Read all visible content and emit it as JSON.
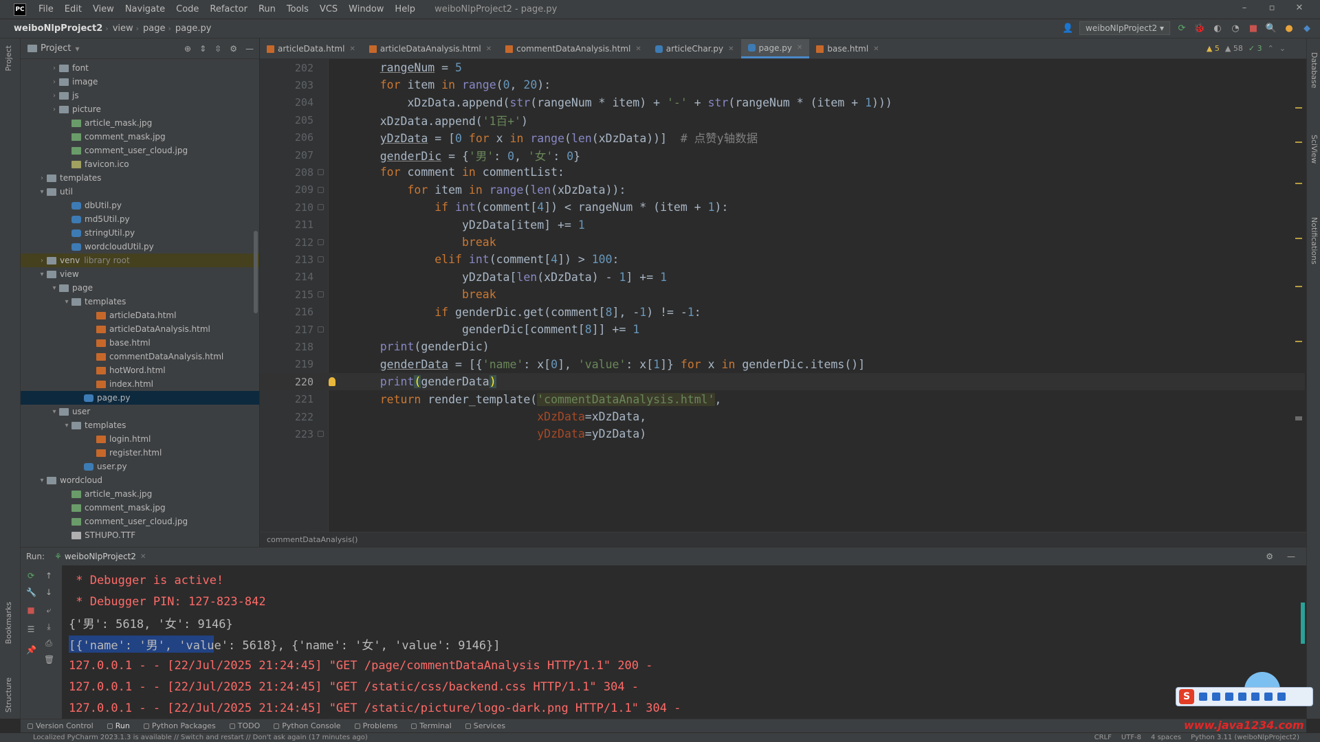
{
  "menubar": {
    "items": [
      "File",
      "Edit",
      "View",
      "Navigate",
      "Code",
      "Refactor",
      "Run",
      "Tools",
      "VCS",
      "Window",
      "Help"
    ],
    "window_title": "weiboNlpProject2 - page.py"
  },
  "navbar": {
    "project": "weiboNlpProject2",
    "path": [
      "view",
      "page",
      "page.py"
    ],
    "run_config": "weiboNlpProject2"
  },
  "project_panel": {
    "title": "Project",
    "tree": [
      {
        "label": "font",
        "type": "folder",
        "depth": 2,
        "open": false
      },
      {
        "label": "image",
        "type": "folder",
        "depth": 2,
        "open": false
      },
      {
        "label": "js",
        "type": "folder",
        "depth": 2,
        "open": false
      },
      {
        "label": "picture",
        "type": "folder",
        "depth": 2,
        "open": false
      },
      {
        "label": "article_mask.jpg",
        "type": "img",
        "depth": 3
      },
      {
        "label": "comment_mask.jpg",
        "type": "img",
        "depth": 3
      },
      {
        "label": "comment_user_cloud.jpg",
        "type": "img",
        "depth": 3
      },
      {
        "label": "favicon.ico",
        "type": "ico",
        "depth": 3
      },
      {
        "label": "templates",
        "type": "folder",
        "depth": 1,
        "open": false
      },
      {
        "label": "util",
        "type": "folder",
        "depth": 1,
        "open": true
      },
      {
        "label": "dbUtil.py",
        "type": "py",
        "depth": 3
      },
      {
        "label": "md5Util.py",
        "type": "py",
        "depth": 3
      },
      {
        "label": "stringUtil.py",
        "type": "py",
        "depth": 3
      },
      {
        "label": "wordcloudUtil.py",
        "type": "py",
        "depth": 3
      },
      {
        "label": "venv",
        "sub": "library root",
        "type": "folder",
        "depth": 1,
        "open": false,
        "highlight": true
      },
      {
        "label": "view",
        "type": "folder",
        "depth": 1,
        "open": true
      },
      {
        "label": "page",
        "type": "folder",
        "depth": 2,
        "open": true
      },
      {
        "label": "templates",
        "type": "folder",
        "depth": 3,
        "open": true
      },
      {
        "label": "articleData.html",
        "type": "html",
        "depth": 5
      },
      {
        "label": "articleDataAnalysis.html",
        "type": "html",
        "depth": 5
      },
      {
        "label": "base.html",
        "type": "html",
        "depth": 5
      },
      {
        "label": "commentDataAnalysis.html",
        "type": "html",
        "depth": 5
      },
      {
        "label": "hotWord.html",
        "type": "html",
        "depth": 5
      },
      {
        "label": "index.html",
        "type": "html",
        "depth": 5
      },
      {
        "label": "page.py",
        "type": "py",
        "depth": 4,
        "selected": true
      },
      {
        "label": "user",
        "type": "folder",
        "depth": 2,
        "open": true
      },
      {
        "label": "templates",
        "type": "folder",
        "depth": 3,
        "open": true
      },
      {
        "label": "login.html",
        "type": "html",
        "depth": 5
      },
      {
        "label": "register.html",
        "type": "html",
        "depth": 5
      },
      {
        "label": "user.py",
        "type": "py",
        "depth": 4
      },
      {
        "label": "wordcloud",
        "type": "folder",
        "depth": 1,
        "open": true
      },
      {
        "label": "article_mask.jpg",
        "type": "img",
        "depth": 3
      },
      {
        "label": "comment_mask.jpg",
        "type": "img",
        "depth": 3
      },
      {
        "label": "comment_user_cloud.jpg",
        "type": "img",
        "depth": 3
      },
      {
        "label": "STHUPO.TTF",
        "type": "ttf",
        "depth": 3
      }
    ]
  },
  "editor_tabs": [
    {
      "label": "articleData.html",
      "type": "html"
    },
    {
      "label": "articleDataAnalysis.html",
      "type": "html"
    },
    {
      "label": "commentDataAnalysis.html",
      "type": "html"
    },
    {
      "label": "articleChar.py",
      "type": "py"
    },
    {
      "label": "page.py",
      "type": "py",
      "active": true
    },
    {
      "label": "base.html",
      "type": "html"
    }
  ],
  "inspections": {
    "warnings": "5",
    "weak": "58",
    "ok": "3"
  },
  "code_lines": [
    {
      "n": "202",
      "tokens": [
        [
          "    ",
          ""
        ],
        [
          "rangeNum",
          "ul"
        ],
        [
          " = ",
          ""
        ],
        [
          "5",
          "num"
        ]
      ]
    },
    {
      "n": "203",
      "tokens": [
        [
          "    ",
          ""
        ],
        [
          "for",
          "kw"
        ],
        [
          " item ",
          ""
        ],
        [
          "in",
          "kw"
        ],
        [
          " ",
          ""
        ],
        [
          "range",
          "fn"
        ],
        [
          "(",
          ""
        ],
        [
          "0",
          "num"
        ],
        [
          ", ",
          ""
        ],
        [
          "20",
          "num"
        ],
        [
          "):",
          ""
        ]
      ]
    },
    {
      "n": "204",
      "tokens": [
        [
          "        xDzData.append(",
          ""
        ],
        [
          "str",
          "fn"
        ],
        [
          "(rangeNum * item) + ",
          ""
        ],
        [
          "'-'",
          "str"
        ],
        [
          " + ",
          ""
        ],
        [
          "str",
          "fn"
        ],
        [
          "(rangeNum * (item + ",
          ""
        ],
        [
          "1",
          "num"
        ],
        [
          ")))",
          ""
        ]
      ]
    },
    {
      "n": "205",
      "tokens": [
        [
          "    xDzData.append(",
          ""
        ],
        [
          "'1百+'",
          "str"
        ],
        [
          ")",
          ""
        ]
      ]
    },
    {
      "n": "206",
      "tokens": [
        [
          "    ",
          ""
        ],
        [
          "yDzData",
          "ul"
        ],
        [
          " = [",
          ""
        ],
        [
          "0",
          "num"
        ],
        [
          " ",
          ""
        ],
        [
          "for",
          "kw"
        ],
        [
          " x ",
          ""
        ],
        [
          "in",
          "kw"
        ],
        [
          " ",
          ""
        ],
        [
          "range",
          "fn"
        ],
        [
          "(",
          ""
        ],
        [
          "len",
          "fn"
        ],
        [
          "(xDzData))]  ",
          ""
        ],
        [
          "# 点赞y轴数据",
          "cm"
        ]
      ]
    },
    {
      "n": "207",
      "tokens": [
        [
          "    ",
          ""
        ],
        [
          "genderDic",
          "ul"
        ],
        [
          " = {",
          ""
        ],
        [
          "'男'",
          "str"
        ],
        [
          ": ",
          ""
        ],
        [
          "0",
          "num"
        ],
        [
          ", ",
          ""
        ],
        [
          "'女'",
          "str"
        ],
        [
          ": ",
          ""
        ],
        [
          "0",
          "num"
        ],
        [
          "}",
          ""
        ]
      ]
    },
    {
      "n": "208",
      "fold": true,
      "tokens": [
        [
          "    ",
          ""
        ],
        [
          "for",
          "kw"
        ],
        [
          " comment ",
          ""
        ],
        [
          "in",
          "kw"
        ],
        [
          " commentList:",
          ""
        ]
      ]
    },
    {
      "n": "209",
      "fold": true,
      "tokens": [
        [
          "        ",
          ""
        ],
        [
          "for",
          "kw"
        ],
        [
          " item ",
          ""
        ],
        [
          "in",
          "kw"
        ],
        [
          " ",
          ""
        ],
        [
          "range",
          "fn"
        ],
        [
          "(",
          ""
        ],
        [
          "len",
          "fn"
        ],
        [
          "(xDzData)):",
          ""
        ]
      ]
    },
    {
      "n": "210",
      "fold": true,
      "tokens": [
        [
          "            ",
          ""
        ],
        [
          "if",
          "kw"
        ],
        [
          " ",
          ""
        ],
        [
          "int",
          "fn"
        ],
        [
          "(comment[",
          ""
        ],
        [
          "4",
          "num"
        ],
        [
          "]) < rangeNum * (item + ",
          ""
        ],
        [
          "1",
          "num"
        ],
        [
          "):",
          ""
        ]
      ]
    },
    {
      "n": "211",
      "tokens": [
        [
          "                yDzData[item] += ",
          ""
        ],
        [
          "1",
          "num"
        ]
      ]
    },
    {
      "n": "212",
      "fold": true,
      "tokens": [
        [
          "                ",
          ""
        ],
        [
          "break",
          "kw"
        ]
      ]
    },
    {
      "n": "213",
      "fold": true,
      "tokens": [
        [
          "            ",
          ""
        ],
        [
          "elif",
          "kw"
        ],
        [
          " ",
          ""
        ],
        [
          "int",
          "fn"
        ],
        [
          "(comment[",
          ""
        ],
        [
          "4",
          "num"
        ],
        [
          "]) > ",
          ""
        ],
        [
          "100",
          "num"
        ],
        [
          ":",
          ""
        ]
      ]
    },
    {
      "n": "214",
      "tokens": [
        [
          "                yDzData[",
          ""
        ],
        [
          "len",
          "fn"
        ],
        [
          "(xDzData) - ",
          ""
        ],
        [
          "1",
          "num"
        ],
        [
          "] += ",
          ""
        ],
        [
          "1",
          "num"
        ]
      ]
    },
    {
      "n": "215",
      "fold": true,
      "tokens": [
        [
          "                ",
          ""
        ],
        [
          "break",
          "kw"
        ]
      ]
    },
    {
      "n": "216",
      "tokens": [
        [
          "            ",
          ""
        ],
        [
          "if",
          "kw"
        ],
        [
          " genderDic.get(comment[",
          ""
        ],
        [
          "8",
          "num"
        ],
        [
          "], -",
          ""
        ],
        [
          "1",
          "num"
        ],
        [
          ") != -",
          ""
        ],
        [
          "1",
          "num"
        ],
        [
          ":",
          ""
        ]
      ]
    },
    {
      "n": "217",
      "fold": true,
      "tokens": [
        [
          "                genderDic[comment[",
          ""
        ],
        [
          "8",
          "num"
        ],
        [
          "]] += ",
          ""
        ],
        [
          "1",
          "num"
        ]
      ]
    },
    {
      "n": "218",
      "tokens": [
        [
          "    ",
          ""
        ],
        [
          "print",
          "fn"
        ],
        [
          "(genderDic)",
          ""
        ]
      ]
    },
    {
      "n": "219",
      "tokens": [
        [
          "    ",
          ""
        ],
        [
          "genderData",
          "ul"
        ],
        [
          " = [{",
          ""
        ],
        [
          "'name'",
          "str"
        ],
        [
          ": x[",
          ""
        ],
        [
          "0",
          "num"
        ],
        [
          "], ",
          ""
        ],
        [
          "'value'",
          "str"
        ],
        [
          ": x[",
          ""
        ],
        [
          "1",
          "num"
        ],
        [
          "]} ",
          ""
        ],
        [
          "for",
          "kw"
        ],
        [
          " x ",
          ""
        ],
        [
          "in",
          "kw"
        ],
        [
          " genderDic.items()]",
          ""
        ]
      ]
    },
    {
      "n": "220",
      "current": true,
      "bulb": true,
      "tokens": [
        [
          "    ",
          ""
        ],
        [
          "print",
          "fn"
        ],
        [
          "(",
          "brk"
        ],
        [
          "genderData",
          ""
        ],
        [
          ")",
          "brk"
        ]
      ]
    },
    {
      "n": "221",
      "tokens": [
        [
          "    ",
          ""
        ],
        [
          "return",
          "kw"
        ],
        [
          " render_template(",
          ""
        ],
        [
          "'commentDataAnalysis.html'",
          "hlstr"
        ],
        [
          ",",
          ""
        ]
      ]
    },
    {
      "n": "222",
      "tokens": [
        [
          "                           ",
          ""
        ],
        [
          "xDzData",
          "param"
        ],
        [
          "=xDzData,",
          ""
        ]
      ]
    },
    {
      "n": "223",
      "fold": true,
      "tokens": [
        [
          "                           ",
          ""
        ],
        [
          "yDzData",
          "param"
        ],
        [
          "=yDzData)",
          ""
        ]
      ]
    }
  ],
  "editor_breadcrumb": "commentDataAnalysis()",
  "run_panel": {
    "label": "Run:",
    "tab": "weiboNlpProject2",
    "lines": [
      {
        "parts": [
          [
            " * Debugger is active!",
            "red"
          ]
        ]
      },
      {
        "parts": [
          [
            " * Debugger PIN: 127-823-842",
            "red"
          ]
        ]
      },
      {
        "parts": [
          [
            "{'男': 5618, '女': 9146}",
            "out"
          ]
        ]
      },
      {
        "parts": [
          [
            "[{'name': '男', 'valu",
            "sel"
          ],
          [
            "e': 5618}, {'name': '女', 'value': 9146}]",
            "out"
          ]
        ]
      },
      {
        "parts": [
          [
            "127.0.0.1 - - [22/Jul/2025 21:24:45] \"GET /page/commentDataAnalysis HTTP/1.1\" 200 -",
            "red"
          ]
        ]
      },
      {
        "parts": [
          [
            "127.0.0.1 - - [22/Jul/2025 21:24:45] \"GET /static/css/backend.css HTTP/1.1\" 304 -",
            "red"
          ]
        ]
      },
      {
        "parts": [
          [
            "127.0.0.1 - - [22/Jul/2025 21:24:45] \"GET /static/picture/logo-dark.png HTTP/1.1\" 304 -",
            "red"
          ]
        ]
      }
    ]
  },
  "tool_tabs": [
    "Version Control",
    "Run",
    "Python Packages",
    "TODO",
    "Python Console",
    "Problems",
    "Terminal",
    "Services"
  ],
  "statusbar": {
    "message": "Localized PyCharm 2023.1.3 is available // Switch and restart // Don't ask again (17 minutes ago)",
    "right": [
      "CRLF",
      "UTF-8",
      "4 spaces",
      "Python 3.11 (weiboNlpProject2)"
    ]
  },
  "side_strips": {
    "left": [
      "Project",
      "Bookmarks",
      "Structure"
    ],
    "right": [
      "Database",
      "SciView",
      "Notifications"
    ]
  },
  "watermark": "www.java1234.com",
  "ime": {
    "logo": "S"
  }
}
